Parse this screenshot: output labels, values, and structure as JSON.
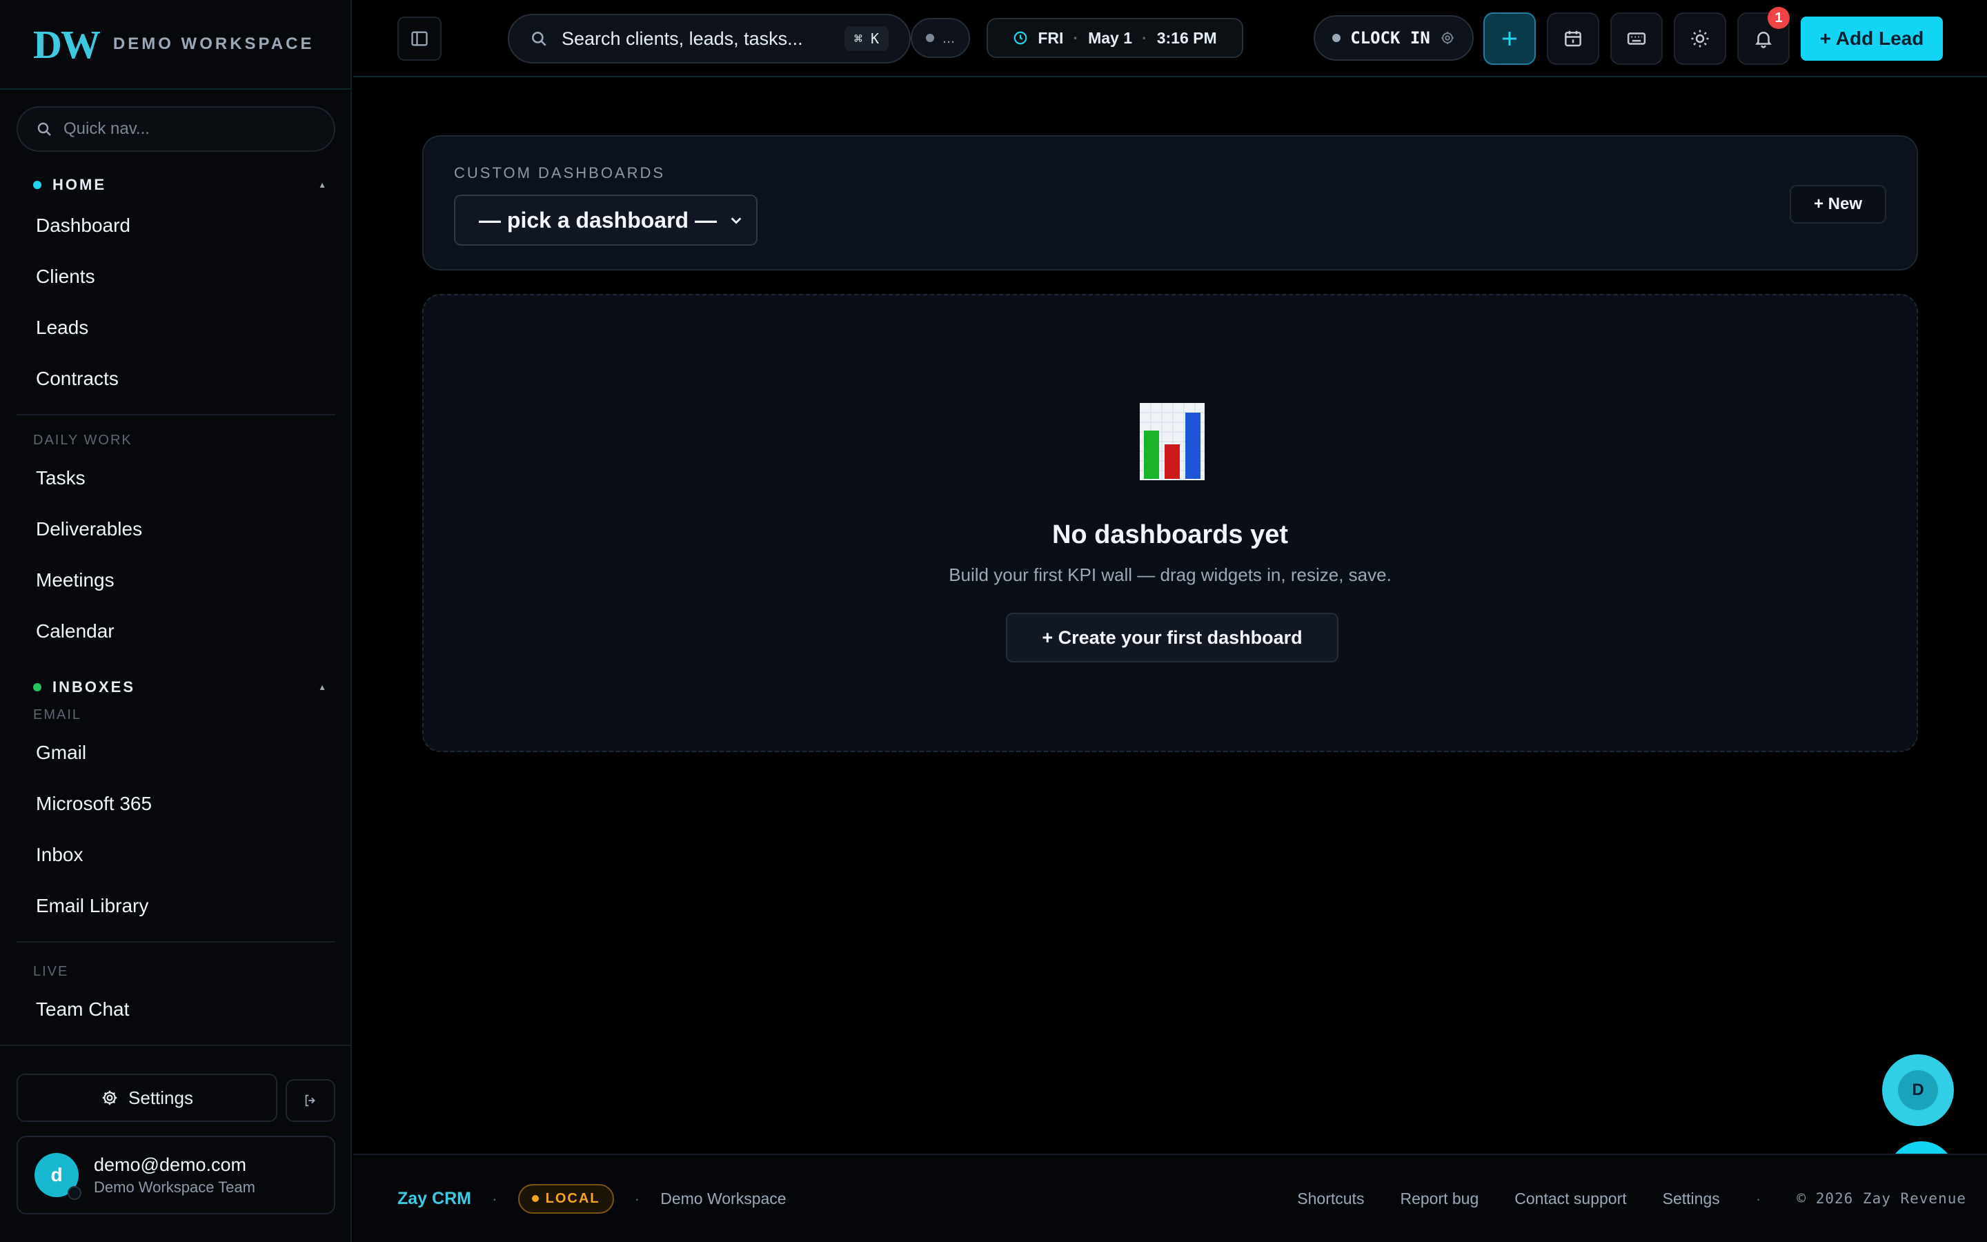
{
  "brand": {
    "logo": "DW",
    "name": "DEMO WORKSPACE"
  },
  "sidebar": {
    "quick_nav_placeholder": "Quick nav...",
    "home": {
      "title": "HOME",
      "items": [
        {
          "label": "Dashboard"
        },
        {
          "label": "Clients"
        },
        {
          "label": "Leads"
        },
        {
          "label": "Contracts"
        }
      ]
    },
    "daily_work": {
      "title": "DAILY WORK",
      "items": [
        {
          "label": "Tasks"
        },
        {
          "label": "Deliverables"
        },
        {
          "label": "Meetings"
        },
        {
          "label": "Calendar"
        }
      ]
    },
    "inboxes": {
      "title": "INBOXES",
      "subtitle": "EMAIL",
      "items": [
        {
          "label": "Gmail"
        },
        {
          "label": "Microsoft 365"
        },
        {
          "label": "Inbox"
        },
        {
          "label": "Email Library"
        }
      ]
    },
    "live": {
      "title": "LIVE",
      "items": [
        {
          "label": "Team Chat"
        }
      ]
    },
    "settings_label": "Settings",
    "user": {
      "initial": "d",
      "email": "demo@demo.com",
      "team": "Demo Workspace Team"
    }
  },
  "topbar": {
    "search_text": "Search clients, leads, tasks...",
    "search_shortcut": "⌘ K",
    "status_text": "...",
    "day": "FRI",
    "date": "May 1",
    "time": "3:16 PM",
    "clock_in": "CLOCK IN",
    "notification_count": "1",
    "add_lead": "+ Add Lead"
  },
  "main": {
    "section_label": "CUSTOM DASHBOARDS",
    "select_value": "— pick a dashboard —",
    "new_button": "+ New",
    "empty_title": "No dashboards yet",
    "empty_subtitle": "Build your first KPI wall — drag widgets in, resize, save.",
    "create_button": "+ Create your first dashboard"
  },
  "floating": {
    "avatar_initial": "D"
  },
  "footer": {
    "brand": "Zay CRM",
    "env_badge": "LOCAL",
    "workspace": "Demo Workspace",
    "links": [
      {
        "label": "Shortcuts"
      },
      {
        "label": "Report bug"
      },
      {
        "label": "Contact support"
      },
      {
        "label": "Settings"
      }
    ],
    "copyright": "© 2026 Zay Revenue"
  },
  "colors": {
    "accent": "#14d4f4",
    "home_dot": "#22d3ee",
    "inboxes_dot": "#22c55e",
    "badge": "#ef4444",
    "local_badge": "#f5a623"
  },
  "icons": {
    "quick_nav": "search-icon",
    "collapse": "sidebar-toggle-icon",
    "clock": "clock-icon",
    "gear": "gear-icon",
    "plus": "plus-icon",
    "calendar": "calendar-icon",
    "keyboard": "keyboard-icon",
    "theme": "sun-icon",
    "notifications": "bell-icon",
    "empty_state": "bar-chart-icon",
    "logout": "logout-icon",
    "bug": "bug-icon"
  }
}
